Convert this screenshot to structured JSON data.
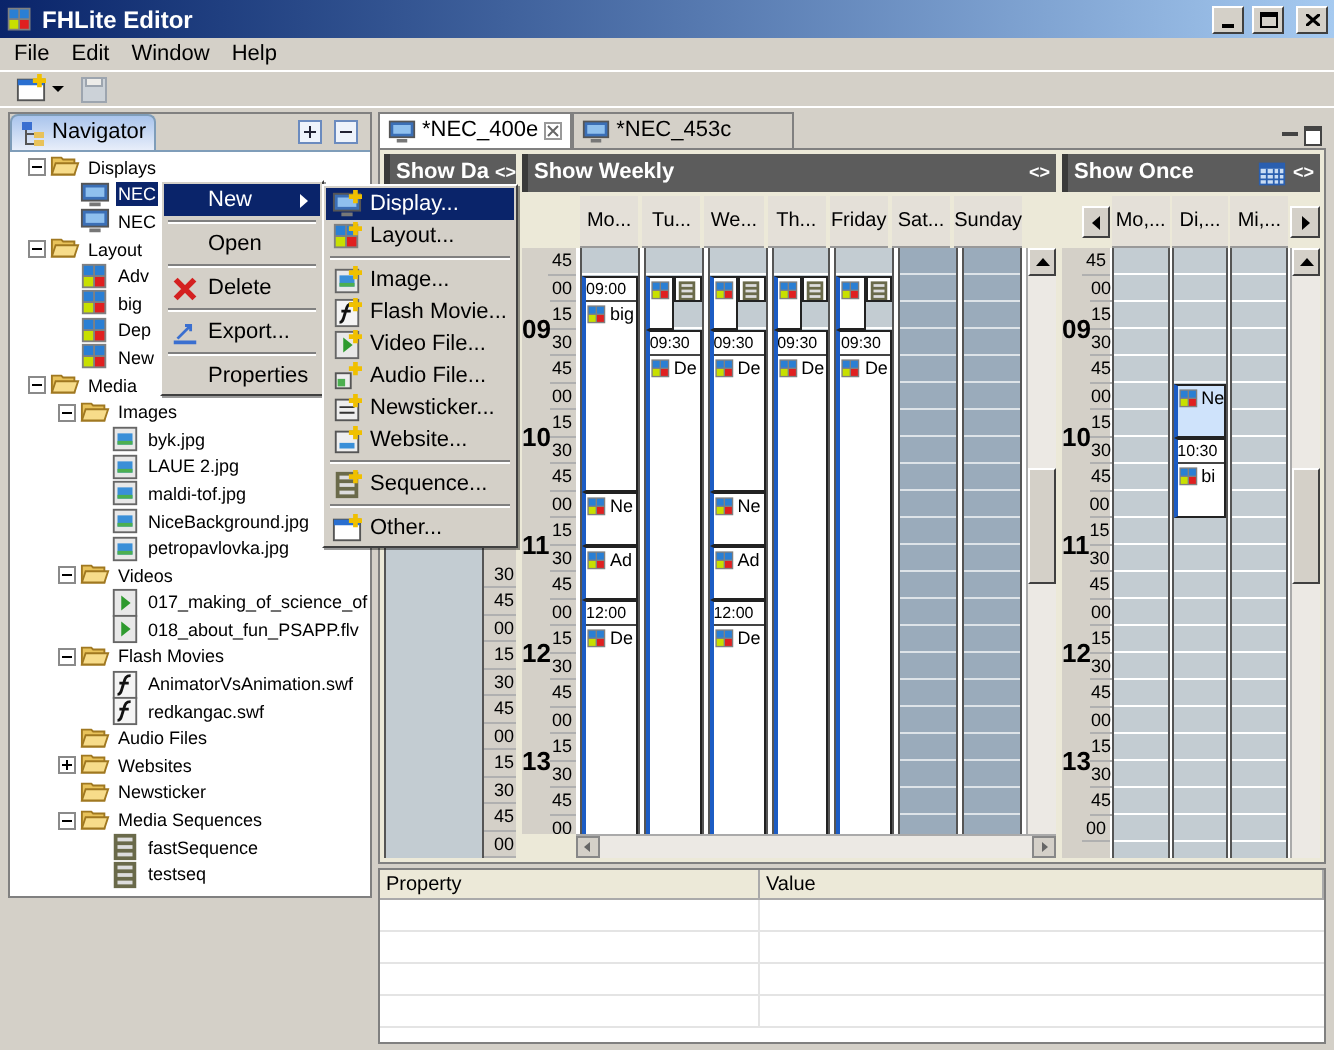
{
  "window": {
    "title": "FHLite Editor"
  },
  "menu_bar": [
    "File",
    "Edit",
    "Window",
    "Help"
  ],
  "navigator": {
    "title": "Navigator",
    "tree": [
      {
        "label": "Displays",
        "kind": "folder",
        "expanded": true,
        "selected": false,
        "children": [
          {
            "label": "NEC",
            "kind": "display",
            "selected": true
          },
          {
            "label": "NEC",
            "kind": "display",
            "selected": false
          }
        ]
      },
      {
        "label": "Layout",
        "kind": "folder",
        "expanded": true,
        "selected": false,
        "children": [
          {
            "label": "Adv",
            "kind": "layout",
            "selected": false
          },
          {
            "label": "big",
            "kind": "layout",
            "selected": false
          },
          {
            "label": "Dep",
            "kind": "layout",
            "selected": false
          },
          {
            "label": "New",
            "kind": "layout",
            "selected": false
          }
        ]
      },
      {
        "label": "Media",
        "kind": "folder",
        "expanded": true,
        "selected": false,
        "children": [
          {
            "label": "Images",
            "kind": "folder",
            "expanded": true,
            "selected": false,
            "children": [
              {
                "label": "byk.jpg",
                "kind": "image",
                "selected": false
              },
              {
                "label": "LAUE 2.jpg",
                "kind": "image",
                "selected": false
              },
              {
                "label": "maldi-tof.jpg",
                "kind": "image",
                "selected": false
              },
              {
                "label": "NiceBackground.jpg",
                "kind": "image",
                "selected": false
              },
              {
                "label": "petropavlovka.jpg",
                "kind": "image",
                "selected": false
              }
            ]
          },
          {
            "label": "Videos",
            "kind": "folder",
            "expanded": true,
            "selected": false,
            "children": [
              {
                "label": "017_making_of_science_of",
                "kind": "video",
                "selected": false
              },
              {
                "label": "018_about_fun_PSAPP.flv",
                "kind": "video",
                "selected": false
              }
            ]
          },
          {
            "label": "Flash Movies",
            "kind": "folder",
            "expanded": true,
            "selected": false,
            "children": [
              {
                "label": "AnimatorVsAnimation.swf",
                "kind": "flash",
                "selected": false
              },
              {
                "label": "redkangac.swf",
                "kind": "flash",
                "selected": false
              }
            ]
          },
          {
            "label": "Audio Files",
            "kind": "folder",
            "selected": false
          },
          {
            "label": "Websites",
            "kind": "folder",
            "expanded": false,
            "selected": false
          },
          {
            "label": "Newsticker",
            "kind": "folder",
            "selected": false
          },
          {
            "label": "Media Sequences",
            "kind": "folder",
            "expanded": true,
            "selected": false,
            "children": [
              {
                "label": "fastSequence",
                "kind": "sequence",
                "selected": false
              },
              {
                "label": "testseq",
                "kind": "sequence",
                "selected": false
              }
            ]
          }
        ]
      }
    ]
  },
  "context_menu": {
    "groups": [
      [
        {
          "label": "New",
          "kind": "submenu",
          "selected": true
        }
      ],
      [
        {
          "label": "Open",
          "kind": "plain",
          "selected": false
        }
      ],
      [
        {
          "label": "Delete",
          "kind": "delete",
          "selected": false
        }
      ],
      [
        {
          "label": "Export...",
          "kind": "export",
          "selected": false
        }
      ],
      [
        {
          "label": "Properties",
          "kind": "plain",
          "selected": false
        }
      ]
    ]
  },
  "new_submenu": {
    "groups": [
      [
        {
          "label": "Display...",
          "kind": "display",
          "selected": true
        },
        {
          "label": "Layout...",
          "kind": "layout",
          "selected": false
        }
      ],
      [
        {
          "label": "Image...",
          "kind": "image",
          "selected": false
        },
        {
          "label": "Flash Movie...",
          "kind": "flash",
          "selected": false
        },
        {
          "label": "Video File...",
          "kind": "video",
          "selected": false
        },
        {
          "label": "Audio File...",
          "kind": "audio",
          "selected": false
        },
        {
          "label": "Newsticker...",
          "kind": "newsticker",
          "selected": false
        },
        {
          "label": "Website...",
          "kind": "website",
          "selected": false
        }
      ],
      [
        {
          "label": "Sequence...",
          "kind": "sequence",
          "selected": false
        }
      ],
      [
        {
          "label": "Other...",
          "kind": "other",
          "selected": false
        }
      ]
    ]
  },
  "editor": {
    "tabs": [
      {
        "label": "*NEC_400e",
        "selected": true,
        "closable": true
      },
      {
        "label": "*NEC_453c",
        "selected": false,
        "closable": false
      }
    ],
    "daily": {
      "title": "Show Da",
      "toggle": "<>",
      "minutes": [
        "30",
        "45",
        "00",
        "15",
        "30",
        "45",
        "00",
        "15",
        "30",
        "45",
        "00"
      ]
    },
    "weekly": {
      "title": "Show Weekly",
      "toggle": "<>",
      "ruler": {
        "lead": [
          "45"
        ],
        "hours": [
          {
            "label": "09",
            "minutes": [
              "00",
              "15",
              "30",
              "45"
            ]
          },
          {
            "label": "10",
            "minutes": [
              "00",
              "15",
              "30",
              "45"
            ]
          },
          {
            "label": "11",
            "minutes": [
              "00",
              "15",
              "30",
              "45"
            ]
          },
          {
            "label": "12",
            "minutes": [
              "00",
              "15",
              "30",
              "45"
            ]
          },
          {
            "label": "13",
            "minutes": [
              "00",
              "15",
              "30",
              "45"
            ]
          }
        ],
        "tail": [
          "00"
        ]
      },
      "days": [
        {
          "label": "Mo...",
          "weekend": false,
          "events": [
            {
              "time": "09:00",
              "kind": "layout",
              "label": "big",
              "selected": false
            },
            {
              "kind": "layout",
              "label": "Ne",
              "selected": false
            },
            {
              "kind": "layout",
              "label": "Ad",
              "selected": false
            },
            {
              "time": "12:00",
              "kind": "layout",
              "label": "De",
              "selected": false
            }
          ]
        },
        {
          "label": "Tu...",
          "weekend": false,
          "events": [
            {
              "kind": "layout",
              "selected": false
            },
            {
              "kind": "sequence",
              "selected": false
            },
            {
              "time": "09:30",
              "kind": "layout",
              "label": "De",
              "selected": false
            }
          ]
        },
        {
          "label": "We...",
          "weekend": false,
          "events": [
            {
              "kind": "layout",
              "selected": false
            },
            {
              "kind": "sequence",
              "selected": false
            },
            {
              "time": "09:30",
              "kind": "layout",
              "label": "De",
              "selected": false
            },
            {
              "kind": "layout",
              "label": "Ne",
              "selected": false
            },
            {
              "kind": "layout",
              "label": "Ad",
              "selected": false
            },
            {
              "time": "12:00",
              "kind": "layout",
              "label": "De",
              "selected": false
            }
          ]
        },
        {
          "label": "Th...",
          "weekend": false,
          "events": [
            {
              "kind": "layout",
              "selected": false
            },
            {
              "kind": "sequence",
              "selected": false
            },
            {
              "time": "09:30",
              "kind": "layout",
              "label": "De",
              "selected": false
            }
          ]
        },
        {
          "label": "Friday",
          "weekend": false,
          "events": [
            {
              "kind": "layout",
              "selected": false
            },
            {
              "kind": "sequence",
              "selected": false
            },
            {
              "time": "09:30",
              "kind": "layout",
              "label": "De",
              "selected": false
            }
          ]
        },
        {
          "label": "Sat...",
          "weekend": true
        },
        {
          "label": "Sunday",
          "weekend": true
        }
      ]
    },
    "once": {
      "title": "Show Once",
      "toggle": "<>",
      "ruler": {
        "lead": [
          "45"
        ],
        "hours": [
          {
            "label": "09",
            "minutes": [
              "00",
              "15",
              "30",
              "45"
            ]
          },
          {
            "label": "10",
            "minutes": [
              "00",
              "15",
              "30",
              "45"
            ]
          },
          {
            "label": "11",
            "minutes": [
              "00",
              "15",
              "30",
              "45"
            ]
          },
          {
            "label": "12",
            "minutes": [
              "00",
              "15",
              "30",
              "45"
            ]
          },
          {
            "label": "13",
            "minutes": [
              "00",
              "15",
              "30",
              "45"
            ]
          }
        ],
        "tail": [
          "00"
        ]
      },
      "days": [
        {
          "label": "Mo,...",
          "weekend": false
        },
        {
          "label": "Di,...",
          "weekend": false,
          "events": [
            {
              "kind": "layout",
              "label": "Ne",
              "selected": true
            },
            {
              "time": "10:30",
              "kind": "layout",
              "label": "bi",
              "selected": false
            }
          ]
        },
        {
          "label": "Mi,...",
          "weekend": false
        }
      ]
    }
  },
  "properties": {
    "columns": [
      "Property",
      "Value"
    ]
  }
}
